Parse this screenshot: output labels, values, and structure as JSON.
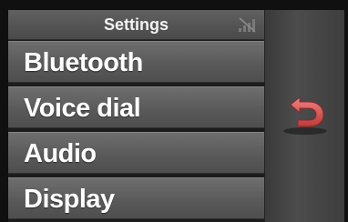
{
  "header": {
    "title": "Settings",
    "status_icon": "signal-off-icon"
  },
  "menu": {
    "items": [
      {
        "label": "Bluetooth"
      },
      {
        "label": "Voice dial"
      },
      {
        "label": "Audio"
      },
      {
        "label": "Display"
      }
    ]
  },
  "side": {
    "back_icon": "back-arrow-icon"
  },
  "colors": {
    "back_arrow": "#e05a5a",
    "item_bg": "#5e5e5e",
    "text": "#ffffff"
  }
}
